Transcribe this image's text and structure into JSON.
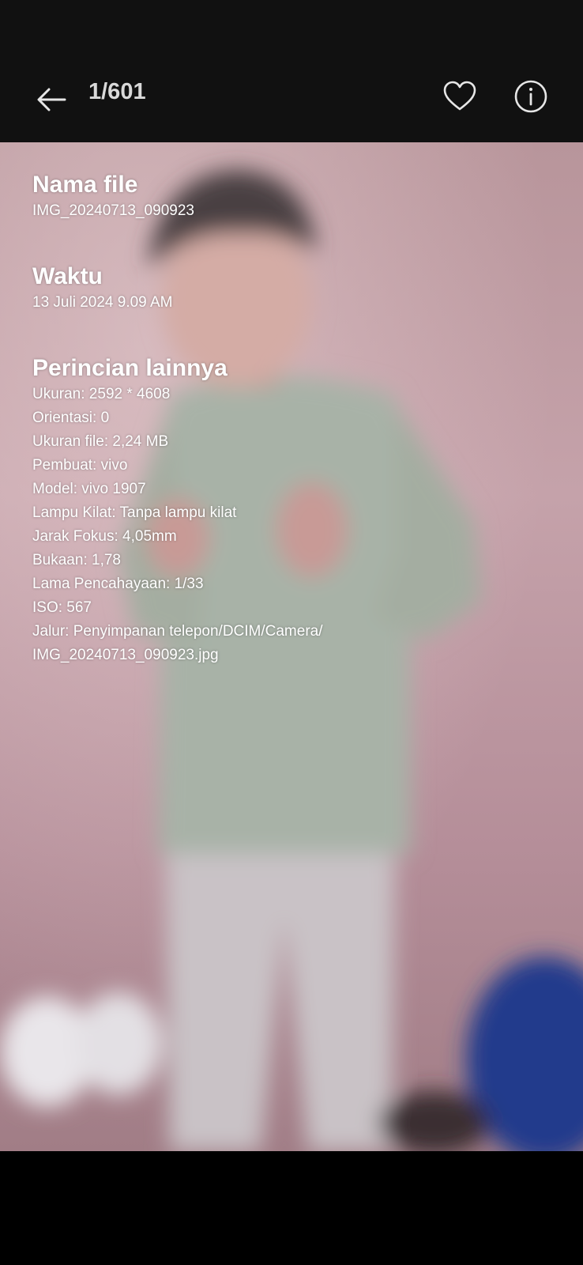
{
  "header": {
    "counter": "1/601"
  },
  "info": {
    "filename_title": "Nama file",
    "filename_value": "IMG_20240713_090923",
    "time_title": "Waktu",
    "time_value": "13 Juli 2024 9.09 AM",
    "other_title": "Perincian lainnya",
    "lines": [
      "Ukuran: 2592 * 4608",
      "Orientasi: 0",
      "Ukuran file: 2,24 MB",
      "Pembuat: vivo",
      "Model: vivo 1907",
      "Lampu Kilat: Tanpa lampu kilat",
      "Jarak Fokus: 4,05mm",
      "Bukaan: 1,78",
      "Lama Pencahayaan: 1/33",
      "ISO: 567",
      "Jalur: Penyimpanan telepon/DCIM/Camera/",
      "IMG_20240713_090923.jpg"
    ]
  },
  "icons": {
    "back": "arrow-left-icon",
    "favorite": "heart-icon",
    "info": "info-icon"
  },
  "colors": {
    "bar_bg": "#111111",
    "text": "#ffffff"
  }
}
